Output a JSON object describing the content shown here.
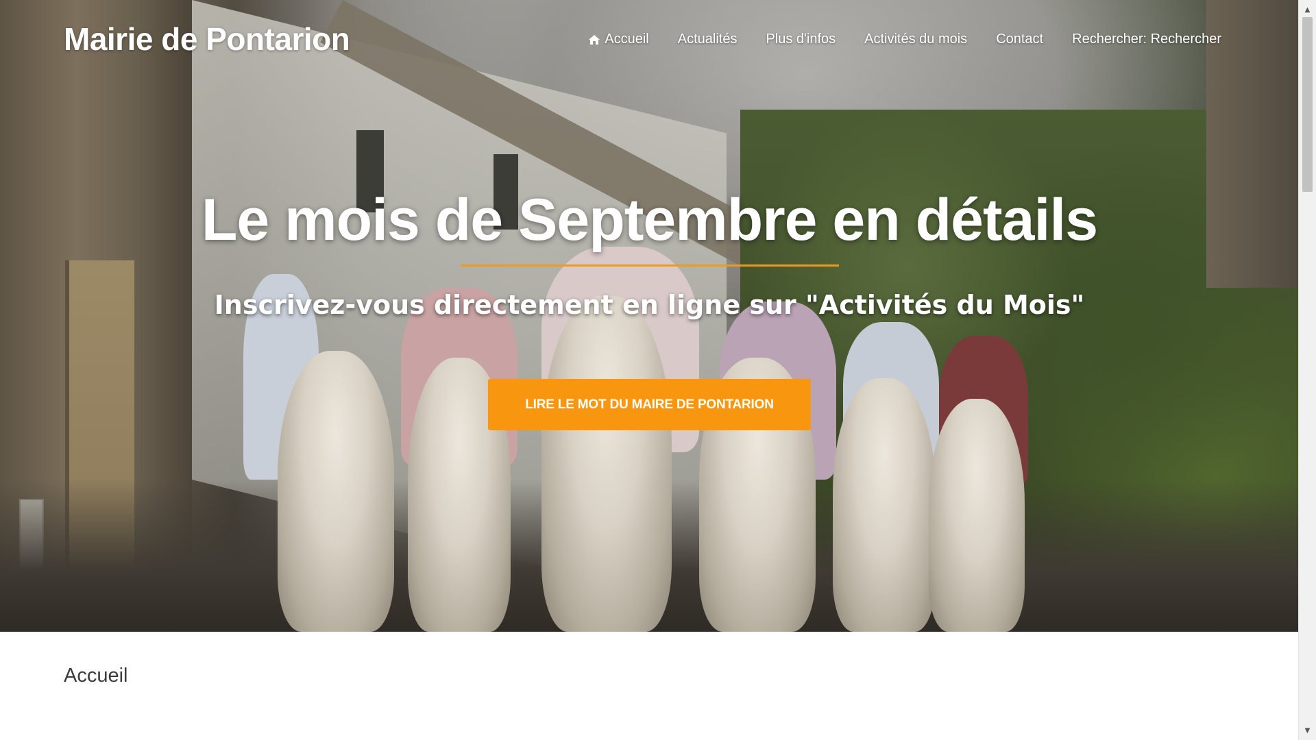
{
  "navbar": {
    "brand": "Mairie de Pontarion",
    "items": [
      {
        "label": "Accueil",
        "icon": "home-icon"
      },
      {
        "label": "Actualités"
      },
      {
        "label": "Plus d'infos"
      },
      {
        "label": "Activités du mois"
      },
      {
        "label": "Contact"
      },
      {
        "label": "Rechercher: Rechercher"
      }
    ]
  },
  "hero": {
    "title": "Le mois de Septembre en détails",
    "subtitle": "Inscrivez-vous directement en ligne sur \"Activités du Mois\"",
    "cta_label": "LIRE LE MOT DU MAIRE DE PONTARION"
  },
  "content": {
    "section_title": "Accueil"
  },
  "colors": {
    "accent": "#f8960f",
    "divider": "#f09a1b",
    "text_dark": "#3b3b3b"
  }
}
